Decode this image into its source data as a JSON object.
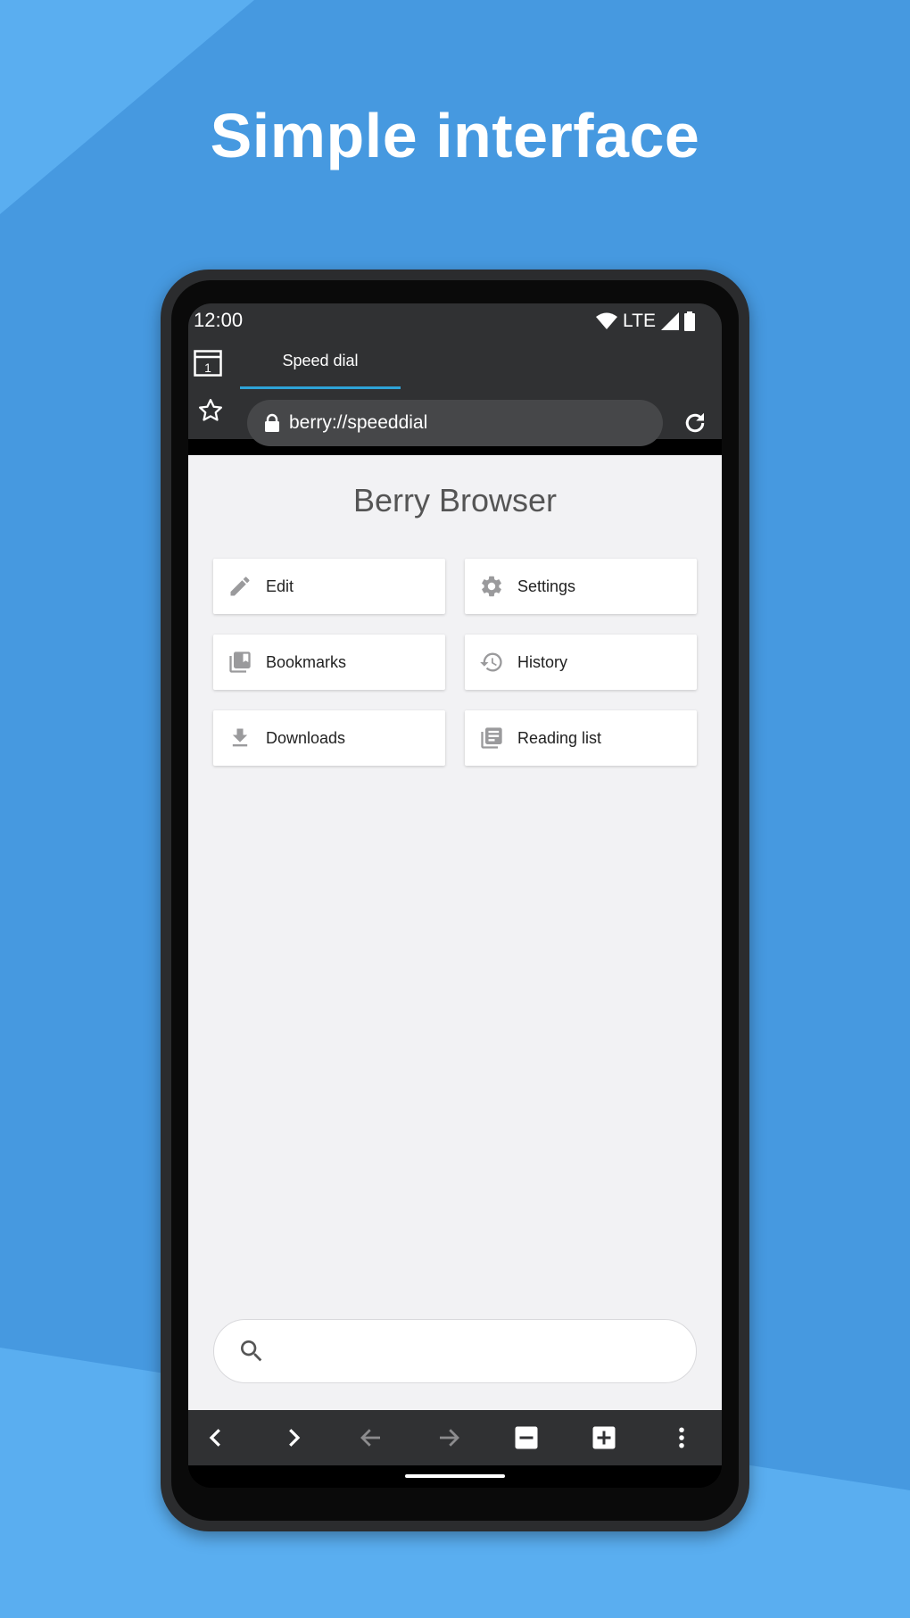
{
  "headline": "Simple interface",
  "colors": {
    "background": "#4699e0",
    "background_light": "#5aaef0",
    "bars": "#303133",
    "urlbar": "#464749",
    "tab_indicator": "#2ea3d8",
    "content_bg": "#f2f2f4",
    "tile_icon": "#9a9a9c"
  },
  "status_bar": {
    "time": "12:00",
    "network": "LTE",
    "icons": [
      "wifi-icon",
      "cell-signal-icon",
      "battery-icon"
    ]
  },
  "tab_bar": {
    "tab_count": "1",
    "active_tab": "Speed dial"
  },
  "toolbar": {
    "url": "berry://speeddial",
    "icons": [
      "star-icon",
      "lock-icon",
      "reload-icon"
    ]
  },
  "speed_dial": {
    "title": "Berry Browser",
    "tiles": [
      {
        "label": "Edit",
        "icon": "pencil-icon"
      },
      {
        "label": "Settings",
        "icon": "gear-icon"
      },
      {
        "label": "Bookmarks",
        "icon": "bookmarks-icon"
      },
      {
        "label": "History",
        "icon": "history-icon"
      },
      {
        "label": "Downloads",
        "icon": "download-icon"
      },
      {
        "label": "Reading list",
        "icon": "reading-list-icon"
      }
    ]
  },
  "search": {
    "placeholder": "",
    "icon": "search-icon"
  },
  "bottom_bar": {
    "buttons": [
      {
        "name": "chevron-left-icon",
        "enabled": true
      },
      {
        "name": "chevron-right-icon",
        "enabled": true
      },
      {
        "name": "arrow-back-icon",
        "enabled": false
      },
      {
        "name": "arrow-forward-icon",
        "enabled": false
      },
      {
        "name": "zoom-out-icon",
        "enabled": true
      },
      {
        "name": "zoom-in-icon",
        "enabled": true
      },
      {
        "name": "more-vert-icon",
        "enabled": true
      }
    ]
  }
}
